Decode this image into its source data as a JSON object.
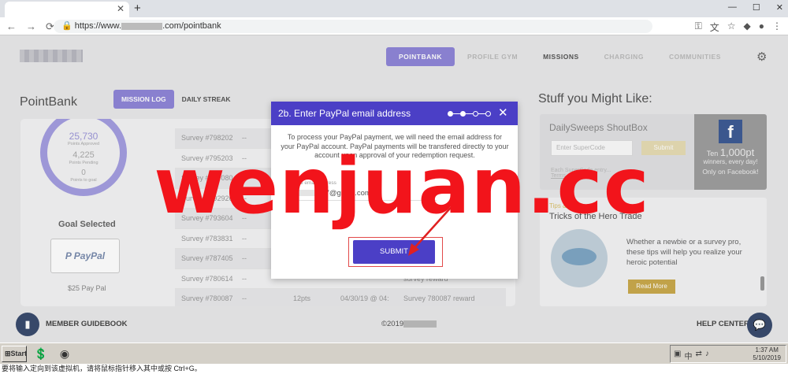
{
  "browser": {
    "url": "https://www.",
    "url_tail": ".com/pointbank",
    "new_tab": "+",
    "nav": {
      "back": "←",
      "forward": "→",
      "reload": "⟳"
    }
  },
  "site": {
    "nav": [
      "POINTBANK",
      "PROFILE GYM",
      "MISSIONS",
      "CHARGING",
      "COMMUNITIES"
    ],
    "page_title": "PointBank",
    "tabs": [
      "MISSION LOG",
      "DAILY STREAK"
    ]
  },
  "points": {
    "approved": "25,730",
    "approved_label": "Points Approved",
    "pending": "4,225",
    "pending_label": "Points Pending",
    "to_goal": "0",
    "to_goal_label": "Points to goal"
  },
  "goal": {
    "heading": "Goal Selected",
    "brand": "PayPal",
    "value": "$25 Pay Pal"
  },
  "mission_log": [
    {
      "survey": "Survey #798202",
      "pts": "--",
      "c3": "",
      "date": "",
      "desc": ""
    },
    {
      "survey": "Survey #795203",
      "pts": "--",
      "c3": "",
      "date": "",
      "desc": ""
    },
    {
      "survey": "Survey #787080",
      "pts": "--",
      "c3": "",
      "date": "",
      "desc": ""
    },
    {
      "survey": "Survey #792926",
      "pts": "--",
      "c3": "",
      "date": "",
      "desc": ""
    },
    {
      "survey": "Survey #793604",
      "pts": "--",
      "c3": "",
      "date": "",
      "desc": ""
    },
    {
      "survey": "Survey #783831",
      "pts": "--",
      "c3": "",
      "date": "",
      "desc": ""
    },
    {
      "survey": "Survey #787405",
      "pts": "--",
      "c3": "",
      "date": "",
      "desc": ""
    },
    {
      "survey": "Survey #780614",
      "pts": "--",
      "c3": "",
      "date": "",
      "desc": "survey reward"
    },
    {
      "survey": "Survey #780087",
      "pts": "--",
      "c3": "12pts",
      "date": "04/30/19 @ 04:",
      "desc": "Survey 780087 reward"
    }
  ],
  "sidebar": {
    "title": "Stuff you Might Like:",
    "shoutbox": {
      "title": "DailySweeps ShoutBox",
      "placeholder": "Enter SuperCode",
      "submit": "Submit",
      "fine_print": "Each SuperCode entry...",
      "terms": "Terms"
    },
    "facebook": {
      "icon": "f",
      "line1_prefix": "Ten ",
      "line1_value": "1,000pt",
      "line2": "winners, every day!",
      "line3": "Only on Facebook!"
    },
    "tips": {
      "category": "Tips & Tricks",
      "title": "Tricks of the Hero Trade",
      "description": "Whether a newbie or a survey pro, these tips will help you realize your heroic potential",
      "button": "Read More"
    }
  },
  "footer": {
    "guidebook": "MEMBER GUIDEBOOK",
    "copyright": "©2019",
    "help": "HELP CENTER"
  },
  "modal": {
    "title": "2b. Enter PayPal email address",
    "body": "To process your PayPal payment, we will need the email address for your PayPal account. PayPal payments will be transfered directly to your account upon approval of your redemption request.",
    "field_label": "PayPal email address",
    "field_value": "777@gmail.com",
    "submit": "SUBMIT",
    "close": "✕",
    "step": 2,
    "total_steps": 4
  },
  "watermark": "wenjuan.cc",
  "taskbar": {
    "start": "Start",
    "time": "1:37 AM",
    "date": "5/10/2019"
  },
  "status_bar": "要将输入定向到该虚拟机，请将鼠标指针移入其中或按 Ctrl+G。"
}
